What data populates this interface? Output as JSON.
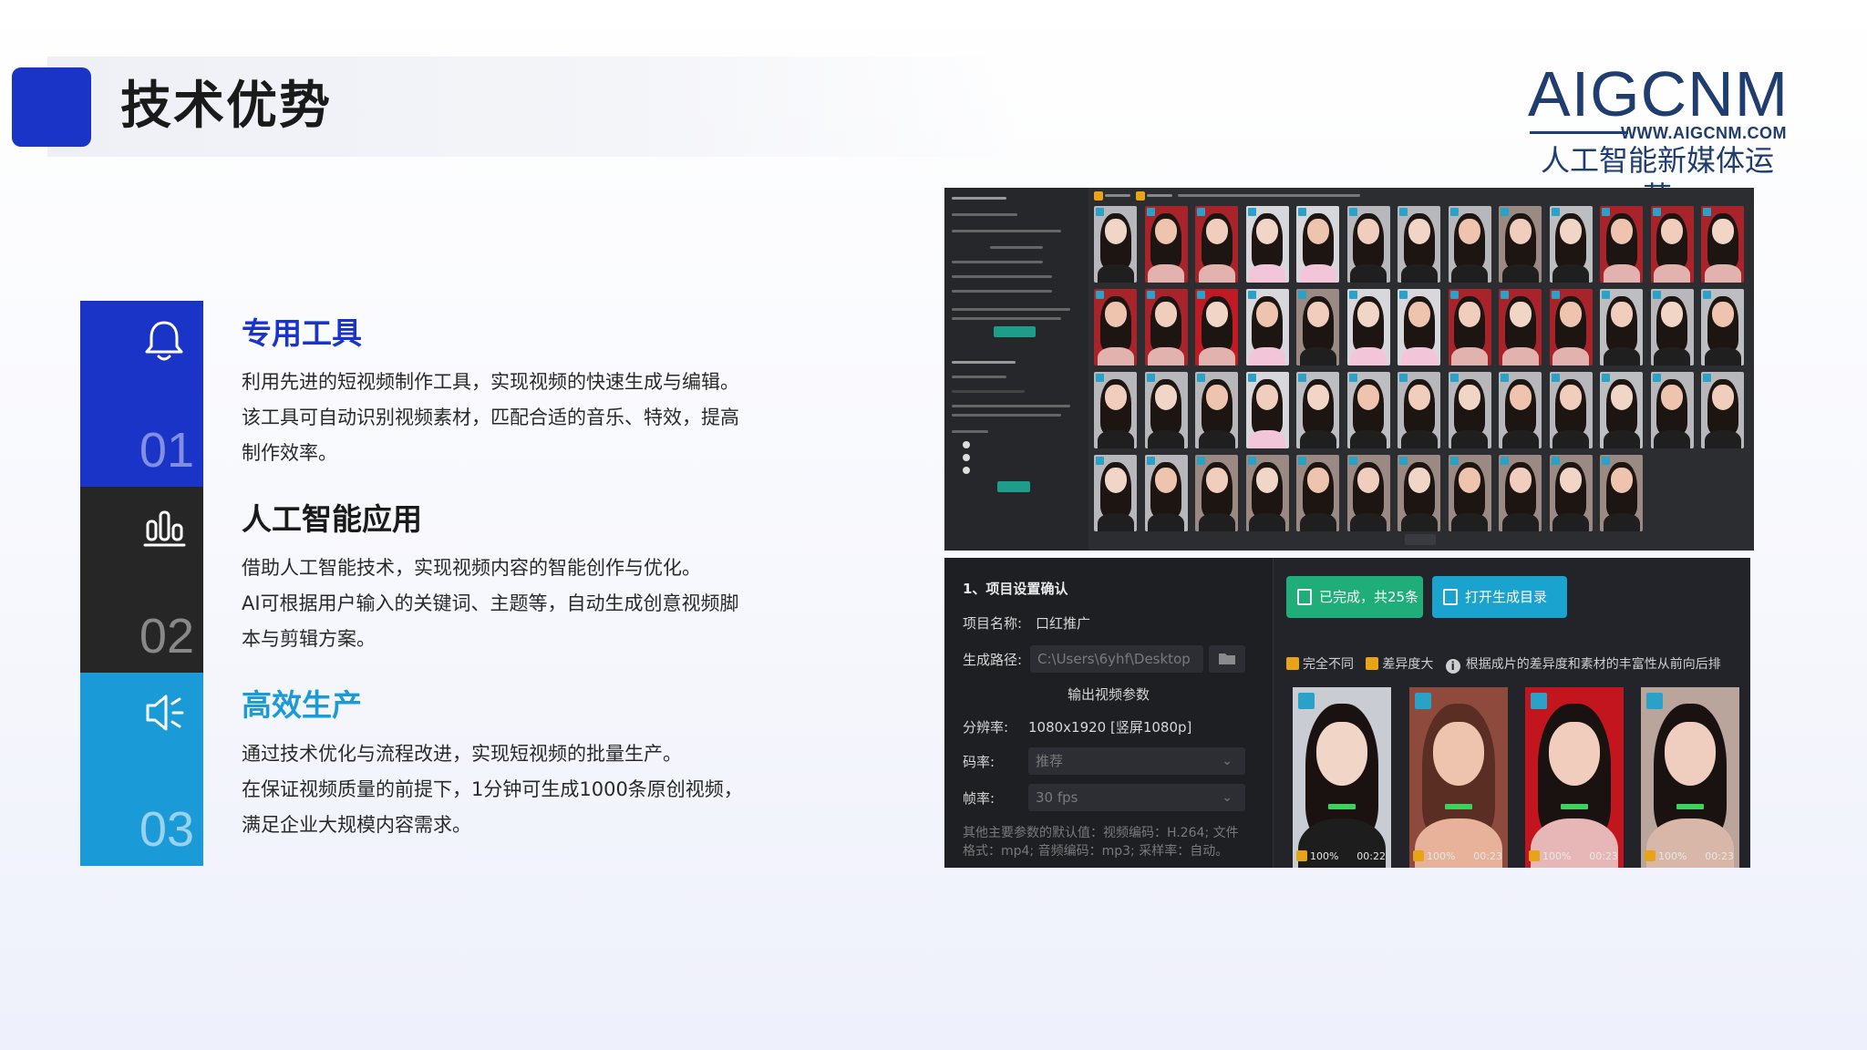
{
  "header": {
    "title": "技术优势"
  },
  "logo": {
    "word": "AIGCNM",
    "url": "WWW.AIGCNM.COM",
    "tagline": "人工智能新媒体运营"
  },
  "features": [
    {
      "number": "01",
      "icon": "bell-icon",
      "heading": "专用工具",
      "lines": [
        "利用先进的短视频制作工具，实现视频的快速生成与编辑。",
        "该工具可自动识别视频素材，匹配合适的音乐、特效，提高",
        "制作效率。"
      ]
    },
    {
      "number": "02",
      "icon": "bar-chart-icon",
      "heading": "人工智能应用",
      "lines": [
        "借助人工智能技术，实现视频内容的智能创作与优化。",
        "AI可根据用户输入的关键词、主题等，自动生成创意视频脚",
        "本与剪辑方案。"
      ]
    },
    {
      "number": "03",
      "icon": "speaker-icon",
      "heading": "高效生产",
      "lines": [
        "通过技术优化与流程改进，实现短视频的批量生产。",
        "在保证视频质量的前提下，1分钟可生成1000条原创视频，",
        "满足企业大规模内容需求。"
      ]
    }
  ],
  "screenshot2": {
    "section_title": "1、项目设置确认",
    "project_name_label": "项目名称:",
    "project_name_value": "口红推广",
    "output_path_label": "生成路径:",
    "output_path_value": "C:\\Users\\6yhf\\Desktop",
    "output_params_title": "输出视频参数",
    "resolution_label": "分辨率:",
    "resolution_value": "1080x1920 [竖屏1080p]",
    "bitrate_label": "码率:",
    "bitrate_value": "推荐",
    "framerate_label": "帧率:",
    "framerate_value": "30 fps",
    "defaults_line1": "其他主要参数的默认值：视频编码：H.264; 文件",
    "defaults_line2": "格式：mp4; 音频编码：mp3; 采样率：自动。",
    "done_button": "已完成，共25条",
    "open_button": "打开生成目录",
    "tag_all_different": "完全不同",
    "tag_large_diff": "差异度大",
    "hint": "根据成片的差异度和素材的丰富性从前向后排",
    "thumbs": [
      {
        "percent": "100%",
        "duration": "00:22"
      },
      {
        "percent": "100%",
        "duration": "00:23"
      },
      {
        "percent": "100%",
        "duration": "00:23"
      },
      {
        "percent": "100%",
        "duration": "00:23"
      }
    ]
  },
  "colors": {
    "brand_blue": "#1b34c8",
    "dark": "#262626",
    "sky": "#1a9bd7",
    "logo_navy": "#1f3d6e"
  }
}
